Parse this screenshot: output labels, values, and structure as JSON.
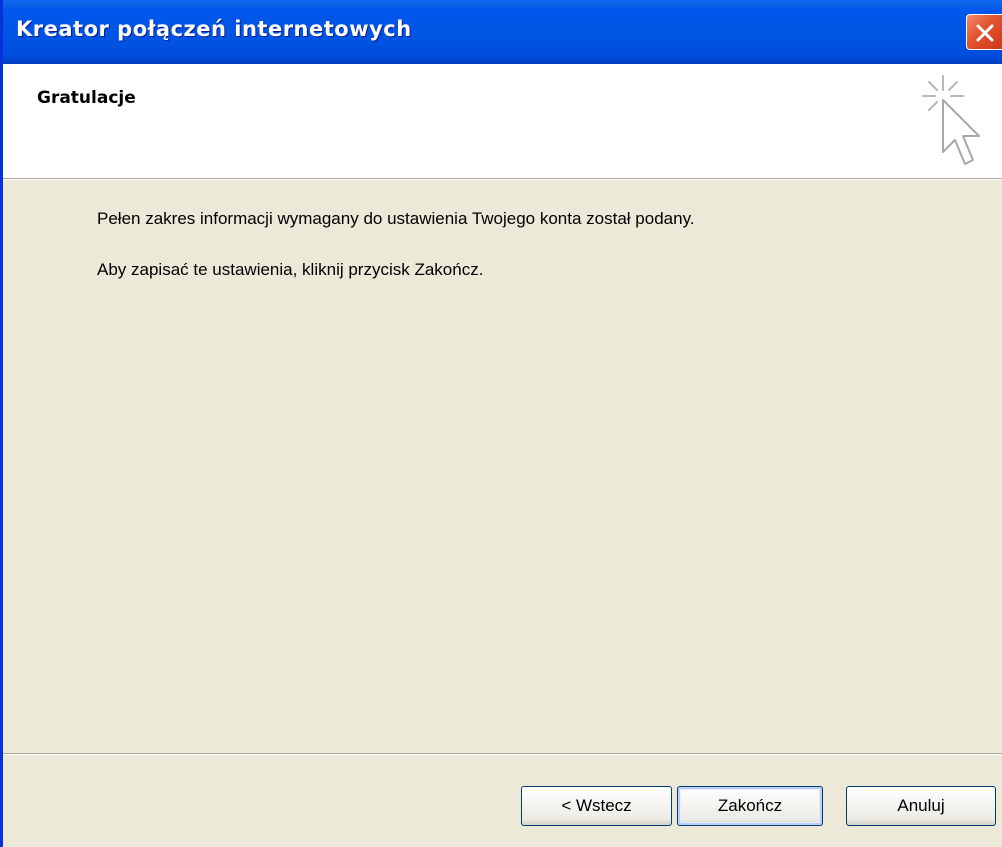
{
  "window": {
    "title": "Kreator połączeń internetowych"
  },
  "header": {
    "title": "Gratulacje",
    "icon": "wizard-cursor-sparkle-icon"
  },
  "content": {
    "line1": "Pełen zakres informacji wymagany do ustawienia Twojego konta został podany.",
    "line2": "Aby zapisać te ustawienia, kliknij przycisk Zakończ."
  },
  "buttons": {
    "back": "< Wstecz",
    "finish": "Zakończ",
    "cancel": "Anuluj"
  },
  "colors": {
    "titlebar": "#0054E3",
    "close": "#E2532E",
    "dialog_bg": "#ECE9D8",
    "button_border": "#003C74"
  }
}
